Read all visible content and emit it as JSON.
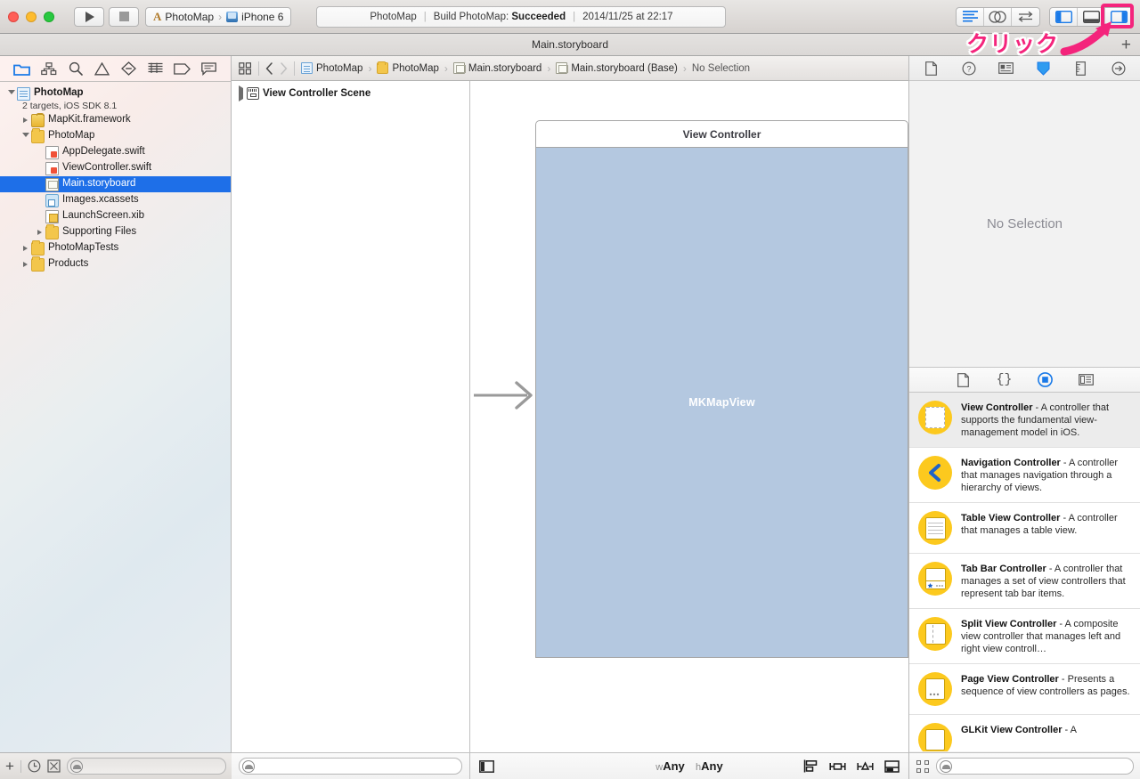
{
  "toolbar": {
    "run_label": "Run",
    "stop_label": "Stop",
    "scheme_project": "PhotoMap",
    "scheme_separator": "〉",
    "scheme_destination": "iPhone 6",
    "status_project": "PhotoMap",
    "status_divider": "|",
    "status_action": "Build PhotoMap:",
    "status_result": "Succeeded",
    "status_timestamp": "2014/11/25 at 22:17",
    "editor_standard": "Standard Editor",
    "editor_assistant": "Assistant Editor",
    "editor_version": "Version Editor",
    "view_navigator": "Hide/Show Navigator",
    "view_debug": "Hide/Show Debug Area",
    "view_utilities": "Hide/Show Utilities"
  },
  "annotation": {
    "text": "クリック",
    "color": "#f4247c",
    "highlight_target": "Hide/Show Utilities"
  },
  "document_bar": {
    "title": "Main.storyboard",
    "add_label": "+"
  },
  "navigator": {
    "tabs": [
      {
        "name": "project-navigator",
        "selected": true
      },
      {
        "name": "symbol-navigator",
        "selected": false
      },
      {
        "name": "search-navigator",
        "selected": false
      },
      {
        "name": "issue-navigator",
        "selected": false
      },
      {
        "name": "test-navigator",
        "selected": false
      },
      {
        "name": "debug-navigator",
        "selected": false
      },
      {
        "name": "breakpoint-navigator",
        "selected": false
      },
      {
        "name": "report-navigator",
        "selected": false
      }
    ],
    "tree": [
      {
        "label": "PhotoMap",
        "sub": "2 targets, iOS SDK 8.1",
        "icon": "project",
        "depth": 0,
        "twisty": "open",
        "bold": true,
        "selected": false
      },
      {
        "label": "MapKit.framework",
        "icon": "framework",
        "depth": 1,
        "twisty": "closed",
        "bold": false,
        "selected": false
      },
      {
        "label": "PhotoMap",
        "icon": "folder",
        "depth": 1,
        "twisty": "open",
        "bold": false,
        "selected": false
      },
      {
        "label": "AppDelegate.swift",
        "icon": "swift",
        "depth": 2,
        "twisty": "none",
        "bold": false,
        "selected": false
      },
      {
        "label": "ViewController.swift",
        "icon": "swift",
        "depth": 2,
        "twisty": "none",
        "bold": false,
        "selected": false
      },
      {
        "label": "Main.storyboard",
        "icon": "storyboard",
        "depth": 2,
        "twisty": "none",
        "bold": false,
        "selected": true
      },
      {
        "label": "Images.xcassets",
        "icon": "xcassets",
        "depth": 2,
        "twisty": "none",
        "bold": false,
        "selected": false
      },
      {
        "label": "LaunchScreen.xib",
        "icon": "xib",
        "depth": 2,
        "twisty": "none",
        "bold": false,
        "selected": false
      },
      {
        "label": "Supporting Files",
        "icon": "folder",
        "depth": 2,
        "twisty": "closed",
        "bold": false,
        "selected": false
      },
      {
        "label": "PhotoMapTests",
        "icon": "folder",
        "depth": 1,
        "twisty": "closed",
        "bold": false,
        "selected": false
      },
      {
        "label": "Products",
        "icon": "folder",
        "depth": 1,
        "twisty": "closed",
        "bold": false,
        "selected": false
      }
    ],
    "bottom": {
      "add_label": "+",
      "filter_placeholder": ""
    }
  },
  "jump_bar": {
    "crumbs": [
      {
        "label": "PhotoMap",
        "icon": "project-file"
      },
      {
        "label": "PhotoMap",
        "icon": "folder"
      },
      {
        "label": "Main.storyboard",
        "icon": "storyboard"
      },
      {
        "label": "Main.storyboard (Base)",
        "icon": "storyboard"
      },
      {
        "label": "No Selection",
        "icon": "none"
      }
    ],
    "chevron": "›"
  },
  "outline": {
    "items": [
      {
        "label": "View Controller Scene",
        "twisty": "closed"
      }
    ],
    "filter_placeholder": ""
  },
  "canvas": {
    "scene_title": "View Controller",
    "subview_label": "MKMapView",
    "subview_color": "#b4c8e0",
    "size_class_prefix_w": "w",
    "size_class_w": "Any",
    "size_class_prefix_h": "h",
    "size_class_h": "Any",
    "buttons": [
      "align-button",
      "pin-button",
      "resolve-auto-layout-issues-button",
      "resizing-behavior-button"
    ]
  },
  "inspector": {
    "tabs": [
      {
        "name": "file-inspector",
        "selected": false
      },
      {
        "name": "quick-help-inspector",
        "selected": false
      },
      {
        "name": "identity-inspector",
        "selected": false
      },
      {
        "name": "attributes-inspector",
        "selected": true
      },
      {
        "name": "size-inspector",
        "selected": false
      },
      {
        "name": "connections-inspector",
        "selected": false
      }
    ],
    "empty_message": "No Selection"
  },
  "library": {
    "tabs": [
      {
        "name": "file-template-library",
        "selected": false
      },
      {
        "name": "code-snippet-library",
        "selected": false
      },
      {
        "name": "object-library",
        "selected": true
      },
      {
        "name": "media-library",
        "selected": false
      }
    ],
    "items": [
      {
        "title": "View Controller",
        "description": " - A controller that supports the fundamental view-management model in iOS.",
        "glyph": "dashed-rect",
        "selected": true
      },
      {
        "title": "Navigation Controller",
        "description": " - A controller that manages navigation through a hierarchy of views.",
        "glyph": "back-chevron",
        "selected": false
      },
      {
        "title": "Table View Controller",
        "description": " - A controller that manages a table view.",
        "glyph": "lines",
        "selected": false
      },
      {
        "title": "Tab Bar Controller",
        "description": " - A controller that manages a set of view controllers that represent tab bar items.",
        "glyph": "tabbar",
        "selected": false
      },
      {
        "title": "Split View Controller",
        "description": " - A composite view controller that manages left and right view controll…",
        "glyph": "split",
        "selected": false
      },
      {
        "title": "Page View Controller",
        "description": " - Presents a sequence of view controllers as pages.",
        "glyph": "page",
        "selected": false
      },
      {
        "title": "GLKit View Controller",
        "description": " - A",
        "glyph": "glkit",
        "selected": false
      }
    ],
    "bottom": {
      "filter_placeholder": ""
    }
  }
}
